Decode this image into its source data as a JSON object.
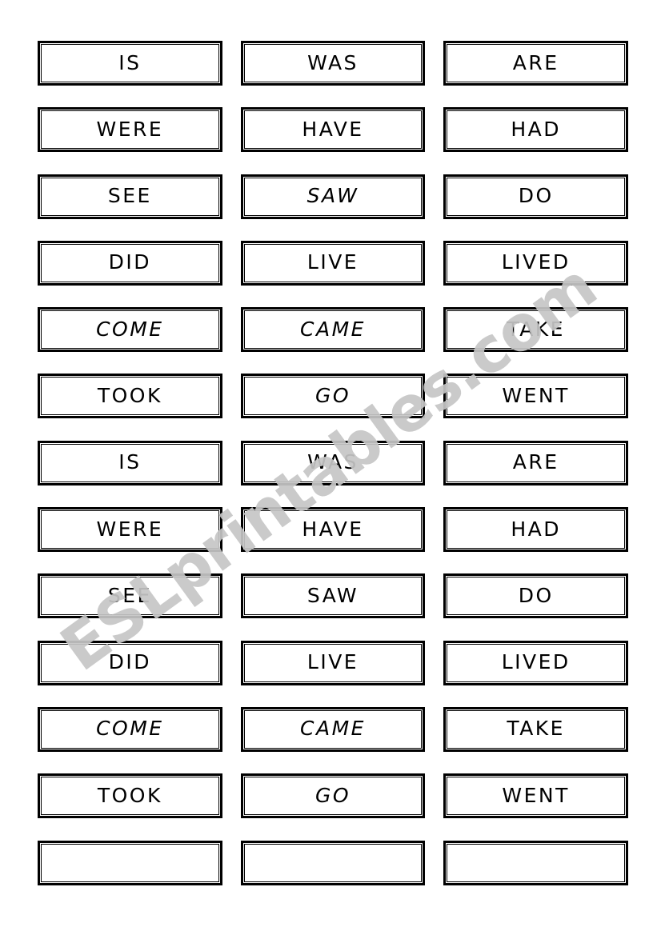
{
  "page": {
    "type": "esl-vocabulary-card-worksheet",
    "background_color": "#ffffff",
    "card_border_color": "#000000",
    "text_color": "#000000",
    "columns": 3,
    "rows": 13
  },
  "watermark": {
    "text": "ESLprintables.com",
    "color": "#c6c6c6",
    "rotation_deg": -36
  },
  "grid": {
    "rows": [
      {
        "cells": [
          {
            "text": "IS",
            "italic": false
          },
          {
            "text": "WAS",
            "italic": false
          },
          {
            "text": "ARE",
            "italic": false
          }
        ]
      },
      {
        "cells": [
          {
            "text": "WERE",
            "italic": false
          },
          {
            "text": "HAVE",
            "italic": false
          },
          {
            "text": "HAD",
            "italic": false
          }
        ]
      },
      {
        "cells": [
          {
            "text": "SEE",
            "italic": false
          },
          {
            "text": "SAW",
            "italic": true
          },
          {
            "text": "DO",
            "italic": false
          }
        ]
      },
      {
        "cells": [
          {
            "text": "DID",
            "italic": false
          },
          {
            "text": "LIVE",
            "italic": false
          },
          {
            "text": "LIVED",
            "italic": false
          }
        ]
      },
      {
        "cells": [
          {
            "text": "COME",
            "italic": true
          },
          {
            "text": "CAME",
            "italic": true
          },
          {
            "text": "TAKE",
            "italic": false
          }
        ]
      },
      {
        "cells": [
          {
            "text": "TOOK",
            "italic": false
          },
          {
            "text": "GO",
            "italic": true
          },
          {
            "text": "WENT",
            "italic": false
          }
        ]
      },
      {
        "cells": [
          {
            "text": "IS",
            "italic": false
          },
          {
            "text": "WAS",
            "italic": false
          },
          {
            "text": "ARE",
            "italic": false
          }
        ]
      },
      {
        "cells": [
          {
            "text": "WERE",
            "italic": false
          },
          {
            "text": "HAVE",
            "italic": false
          },
          {
            "text": "HAD",
            "italic": false
          }
        ]
      },
      {
        "cells": [
          {
            "text": "SEE",
            "italic": false
          },
          {
            "text": "SAW",
            "italic": false
          },
          {
            "text": "DO",
            "italic": false
          }
        ]
      },
      {
        "cells": [
          {
            "text": "DID",
            "italic": false
          },
          {
            "text": "LIVE",
            "italic": false
          },
          {
            "text": "LIVED",
            "italic": false
          }
        ]
      },
      {
        "cells": [
          {
            "text": "COME",
            "italic": true
          },
          {
            "text": "CAME",
            "italic": true
          },
          {
            "text": "TAKE",
            "italic": false
          }
        ]
      },
      {
        "cells": [
          {
            "text": "TOOK",
            "italic": false
          },
          {
            "text": "GO",
            "italic": true
          },
          {
            "text": "WENT",
            "italic": false
          }
        ]
      },
      {
        "cells": [
          {
            "text": "",
            "italic": false
          },
          {
            "text": "",
            "italic": false
          },
          {
            "text": "",
            "italic": false
          }
        ]
      }
    ]
  }
}
